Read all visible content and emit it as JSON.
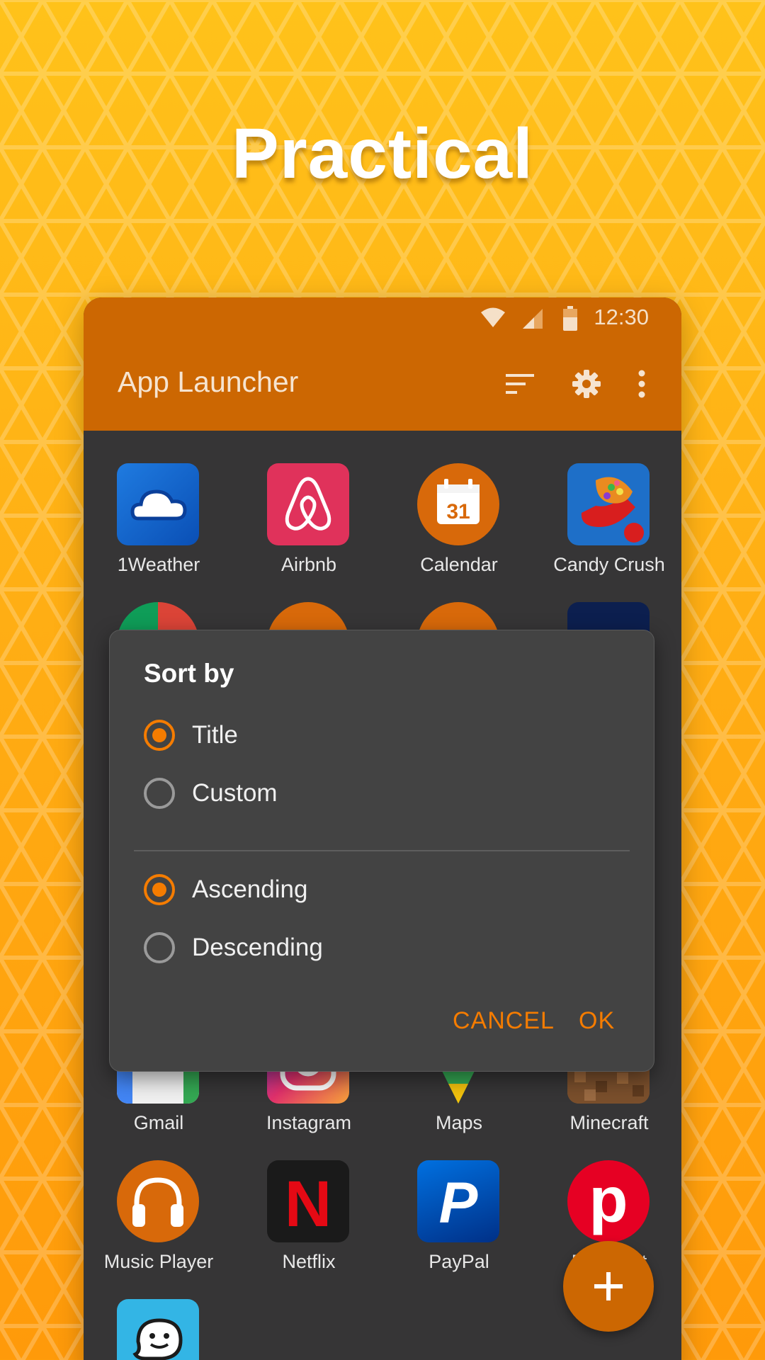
{
  "headline": "Practical",
  "status_bar": {
    "time": "12:30",
    "icons": [
      "wifi-icon",
      "signal-icon",
      "battery-icon"
    ]
  },
  "app_bar": {
    "title": "App Launcher",
    "actions": [
      "sort-icon",
      "settings-gear-icon",
      "more-vert-icon"
    ]
  },
  "apps": [
    {
      "label": "1Weather",
      "icon": "cloud-icon"
    },
    {
      "label": "Airbnb",
      "icon": "airbnb-logo-icon"
    },
    {
      "label": "Calendar",
      "icon": "calendar-icon",
      "icon_text": "31"
    },
    {
      "label": "Candy Crush",
      "icon": "candy-icon"
    },
    {
      "label": "Gmail",
      "icon": "gmail-icon"
    },
    {
      "label": "Instagram",
      "icon": "instagram-icon"
    },
    {
      "label": "Maps",
      "icon": "maps-icon"
    },
    {
      "label": "Minecraft",
      "icon": "minecraft-icon"
    },
    {
      "label": "Music Player",
      "icon": "headphones-icon"
    },
    {
      "label": "Netflix",
      "icon": "netflix-icon",
      "icon_text": "N"
    },
    {
      "label": "PayPal",
      "icon": "paypal-icon",
      "icon_text": "P"
    },
    {
      "label": "Pinterest",
      "icon": "pinterest-icon",
      "icon_text": "p"
    },
    {
      "label": "",
      "icon": "waze-icon"
    }
  ],
  "sort_dialog": {
    "title": "Sort by",
    "sort_field_options": [
      {
        "label": "Title",
        "checked": true
      },
      {
        "label": "Custom",
        "checked": false
      }
    ],
    "order_options": [
      {
        "label": "Ascending",
        "checked": true
      },
      {
        "label": "Descending",
        "checked": false
      }
    ],
    "cancel_label": "CANCEL",
    "ok_label": "OK"
  },
  "fab": {
    "icon": "plus-icon"
  },
  "colors": {
    "accent": "#f57c00",
    "app_bar": "#cc6702",
    "background": "#ffb412",
    "surface": "#363536",
    "dialog": "#434343"
  }
}
